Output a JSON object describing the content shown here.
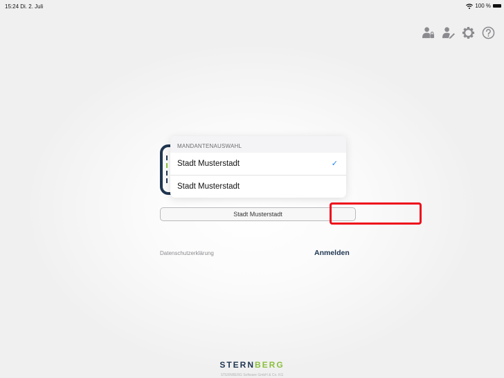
{
  "status_bar": {
    "time": "15:24  Di. 2. Juli",
    "battery": "100 %"
  },
  "toolbar": {
    "icons": [
      "user-lock-icon",
      "user-edit-icon",
      "gear-icon",
      "help-icon"
    ]
  },
  "popover": {
    "header": "MANDANTENAUSWAHL",
    "items": [
      {
        "label": "Stadt Musterstadt",
        "selected": true
      },
      {
        "label": "Stadt Musterstadt",
        "selected": false
      }
    ],
    "check": "✓"
  },
  "select": {
    "value": "Stadt Musterstadt"
  },
  "links": {
    "privacy": "Datenschutzerklärung",
    "login": "Anmelden"
  },
  "brand": {
    "part1": "STERN",
    "part2": "BERG",
    "accent_color": "#8bbf3c",
    "primary_color": "#1f3550"
  },
  "footer": {
    "text": "STERNBERG Software GmbH & Co. KG"
  },
  "highlight_color": "#ee0a1a"
}
